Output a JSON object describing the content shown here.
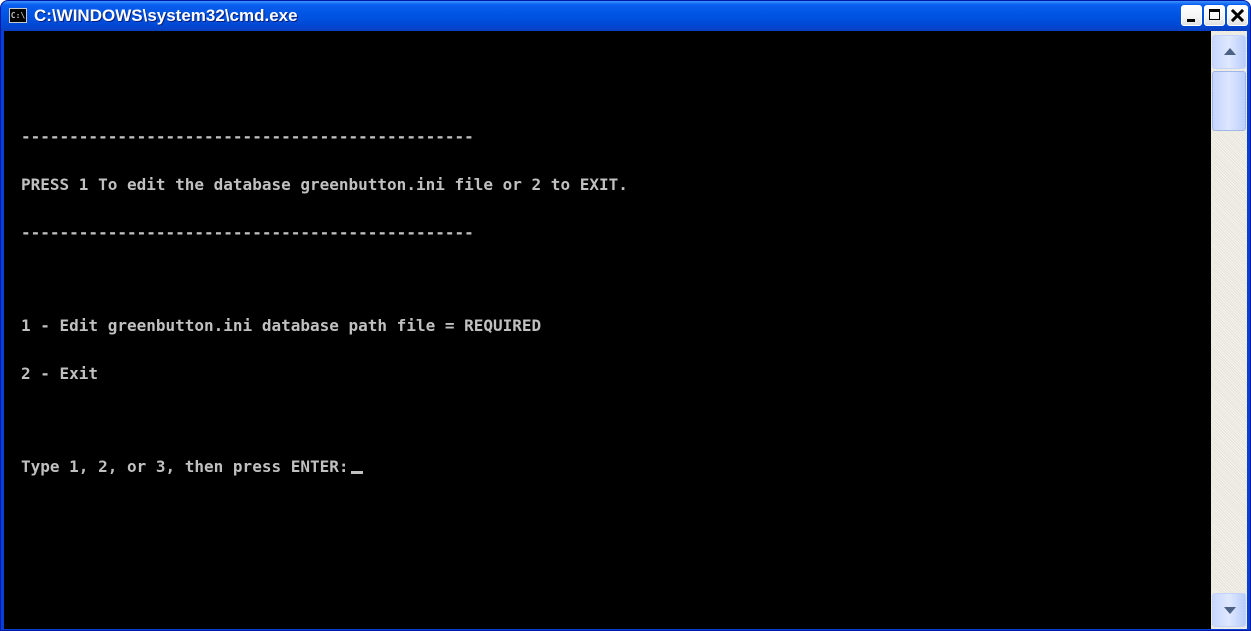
{
  "window": {
    "title": "C:\\WINDOWS\\system32\\cmd.exe",
    "icon": "command-prompt-icon",
    "icon_text": "C:\\",
    "controls": {
      "minimize_icon": "minimize-icon",
      "maximize_icon": "maximize-icon",
      "close_icon": "close-icon"
    }
  },
  "console": {
    "text_color": "#c0c0c0",
    "background_color": "#000000",
    "separator_top": "-----------------------------------------------",
    "prompt_header": "PRESS 1 To edit the database greenbutton.ini file or 2 to EXIT.",
    "separator_bottom": "-----------------------------------------------",
    "options": [
      "1 - Edit greenbutton.ini database path file = REQUIRED",
      "2 - Exit"
    ],
    "input_prompt": "Type 1, 2, or 3, then press ENTER:"
  },
  "scrollbar": {
    "up_icon": "scroll-up-arrow-icon",
    "down_icon": "scroll-down-arrow-icon"
  }
}
